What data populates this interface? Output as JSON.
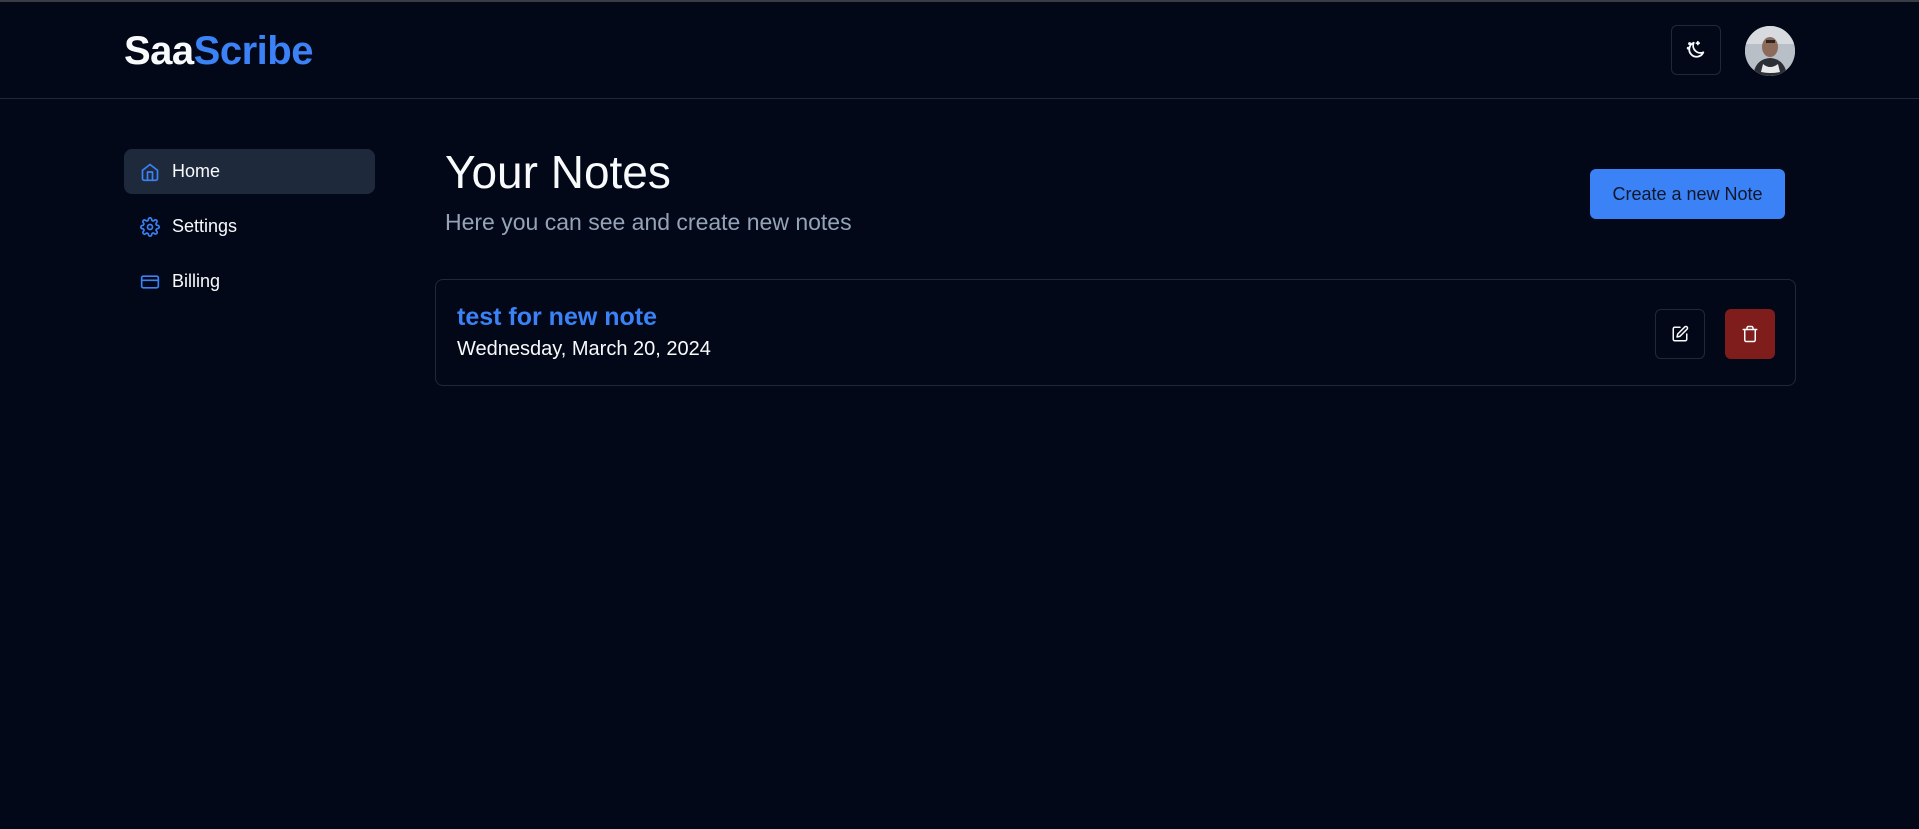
{
  "header": {
    "logo_part1": "Saa",
    "logo_part2": "Scribe",
    "theme_toggle_icon": "moon-stars-icon",
    "avatar_icon": "user-avatar"
  },
  "sidebar": {
    "items": [
      {
        "label": "Home",
        "icon": "home-icon",
        "active": true
      },
      {
        "label": "Settings",
        "icon": "gear-icon",
        "active": false
      },
      {
        "label": "Billing",
        "icon": "credit-card-icon",
        "active": false
      }
    ]
  },
  "main": {
    "title": "Your Notes",
    "subtitle": "Here you can see and create new notes",
    "create_button_label": "Create a new Note",
    "notes": [
      {
        "title": "test for new note",
        "date": "Wednesday, March 20, 2024",
        "edit_icon": "edit-icon",
        "delete_icon": "trash-icon"
      }
    ]
  },
  "colors": {
    "background": "#020817",
    "accent": "#3b82f6",
    "muted_text": "#94a3b8",
    "border": "#1e293b",
    "danger": "#7f1d1d"
  }
}
